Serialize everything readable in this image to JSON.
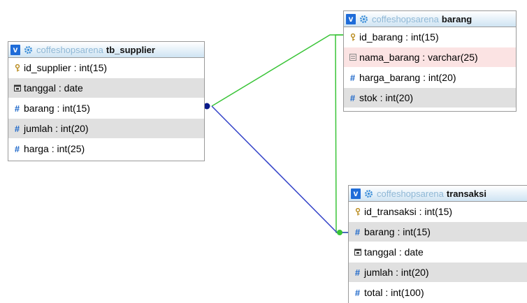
{
  "colors": {
    "accent": "#1f6cd8",
    "header_grad_end": "#cfe4f3",
    "row_alt": "#e0e0e0",
    "row_highlight": "#fbe3e3",
    "relation_green": "#39c437",
    "relation_blue": "#3342c8"
  },
  "tables": [
    {
      "id": "tb_supplier",
      "collapse": "v",
      "database": "coffeshopsarena",
      "name": "tb_supplier",
      "columns": [
        {
          "icon": "key-icon",
          "label": "id_supplier : int(15)"
        },
        {
          "icon": "date-icon",
          "label": "tanggal : date"
        },
        {
          "icon": "number-icon",
          "label": "barang : int(15)"
        },
        {
          "icon": "number-icon",
          "label": "jumlah : int(20)"
        },
        {
          "icon": "number-icon",
          "label": "harga : int(25)"
        }
      ]
    },
    {
      "id": "barang",
      "collapse": "v",
      "database": "coffeshopsarena",
      "name": "barang",
      "columns": [
        {
          "icon": "key-icon",
          "label": "id_barang : int(15)"
        },
        {
          "icon": "text-icon",
          "label": "nama_barang : varchar(25)"
        },
        {
          "icon": "number-icon",
          "label": "harga_barang : int(20)"
        },
        {
          "icon": "number-icon",
          "label": "stok : int(20)"
        }
      ]
    },
    {
      "id": "transaksi",
      "collapse": "v",
      "database": "coffeshopsarena",
      "name": "transaksi",
      "columns": [
        {
          "icon": "key-icon",
          "label": "id_transaksi : int(15)"
        },
        {
          "icon": "number-icon",
          "label": "barang : int(15)"
        },
        {
          "icon": "date-icon",
          "label": "tanggal : date"
        },
        {
          "icon": "number-icon",
          "label": "jumlah : int(20)"
        },
        {
          "icon": "number-icon",
          "label": "total : int(100)"
        }
      ]
    }
  ]
}
